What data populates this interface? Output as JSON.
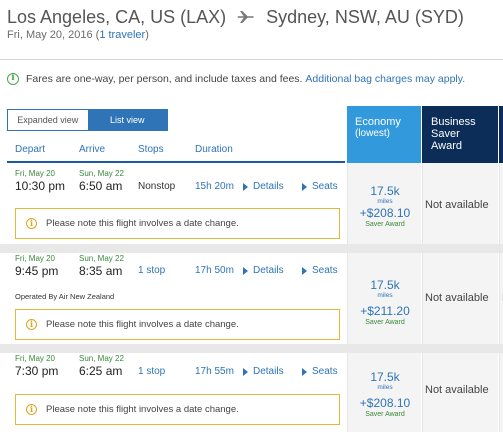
{
  "header": {
    "origin": "Los Angeles, CA, US (LAX)",
    "destination": "Sydney, NSW, AU (SYD)",
    "date": "Fri, May 20, 2016",
    "travelers_prefix": "(",
    "travelers_link": "1 traveler",
    "travelers_suffix": ")"
  },
  "notice": {
    "text": "Fares are one-way, per person, and include taxes and fees.",
    "link": "Additional bag charges may apply."
  },
  "view_toggle": {
    "expanded": "Expanded view",
    "list": "List view",
    "active": "list"
  },
  "columns": {
    "depart": "Depart",
    "arrive": "Arrive",
    "stops": "Stops",
    "duration": "Duration"
  },
  "cabins": {
    "economy_line1": "Economy",
    "economy_line2": "(lowest)",
    "business_line1": "Business",
    "business_line2": "Saver",
    "business_line3": "Award"
  },
  "flights": [
    {
      "dep_date": "Fri, May 20",
      "dep_time": "10:30 pm",
      "arr_date": "Sun, May 22",
      "arr_time": "6:50 am",
      "stops": "Nonstop",
      "duration": "15h 20m",
      "details": "Details",
      "seats": "Seats",
      "operated_by": "",
      "warning": "Please note this flight involves a date change.",
      "miles": "17.5k",
      "miles_unit": "miles",
      "taxes": "+$208.10",
      "award_type": "Saver Award",
      "business": "Not available",
      "third": ""
    },
    {
      "dep_date": "Fri, May 20",
      "dep_time": "9:45 pm",
      "arr_date": "Sun, May 22",
      "arr_time": "8:35 am",
      "stops": "1 stop",
      "duration": "17h 50m",
      "details": "Details",
      "seats": "Seats",
      "operated_by": "Operated By Air New Zealand",
      "warning": "Please note this flight involves a date change.",
      "miles": "17.5k",
      "miles_unit": "miles",
      "taxes": "+$211.20",
      "award_type": "Saver Award",
      "business": "Not available",
      "third": "N"
    },
    {
      "dep_date": "Fri, May 20",
      "dep_time": "7:30 pm",
      "arr_date": "Sun, May 22",
      "arr_time": "6:25 am",
      "stops": "1 stop",
      "duration": "17h 55m",
      "details": "Details",
      "seats": "Seats",
      "operated_by": "",
      "warning": "Please note this flight involves a date change.",
      "miles": "17.5k",
      "miles_unit": "miles",
      "taxes": "+$208.10",
      "award_type": "Saver Award",
      "business": "Not available",
      "third": ""
    }
  ],
  "colors": {
    "link": "#2f74b7",
    "economy_header": "#3399dd",
    "business_header": "#0c2d57",
    "date_green": "#3a8a3a",
    "warning_border": "#e3b73c"
  }
}
